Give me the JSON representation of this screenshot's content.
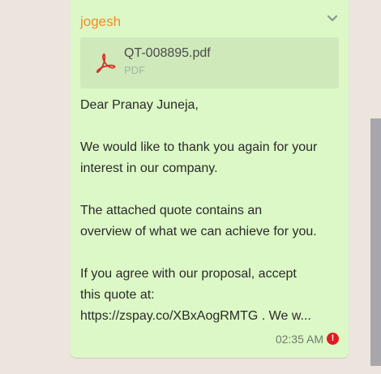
{
  "message": {
    "sender": "jogesh",
    "attachment": {
      "file_name": "QT-008895.pdf",
      "file_type": "PDF",
      "icon": "pdf-icon"
    },
    "lines": {
      "greeting": "Dear Pranay Juneja,",
      "thanks_1": "We would like to thank you again for your",
      "thanks_2": "interest in our company.",
      "quote_1": "The attached quote contains an",
      "quote_2": "overview of what we can achieve for you.",
      "accept_1": "If you agree with our proposal, accept",
      "accept_2": "this quote at:",
      "accept_3": "https://zspay.co/XBxAogRMTG . We w..."
    },
    "time": "02:35 AM",
    "status_icon": "error-icon",
    "status_symbol": "!"
  },
  "colors": {
    "bubble": "#dcf8c6",
    "sender": "#f08c26",
    "error": "#e21c1c",
    "background": "#ece5dd",
    "scrollbar": "#a8a6ab"
  }
}
